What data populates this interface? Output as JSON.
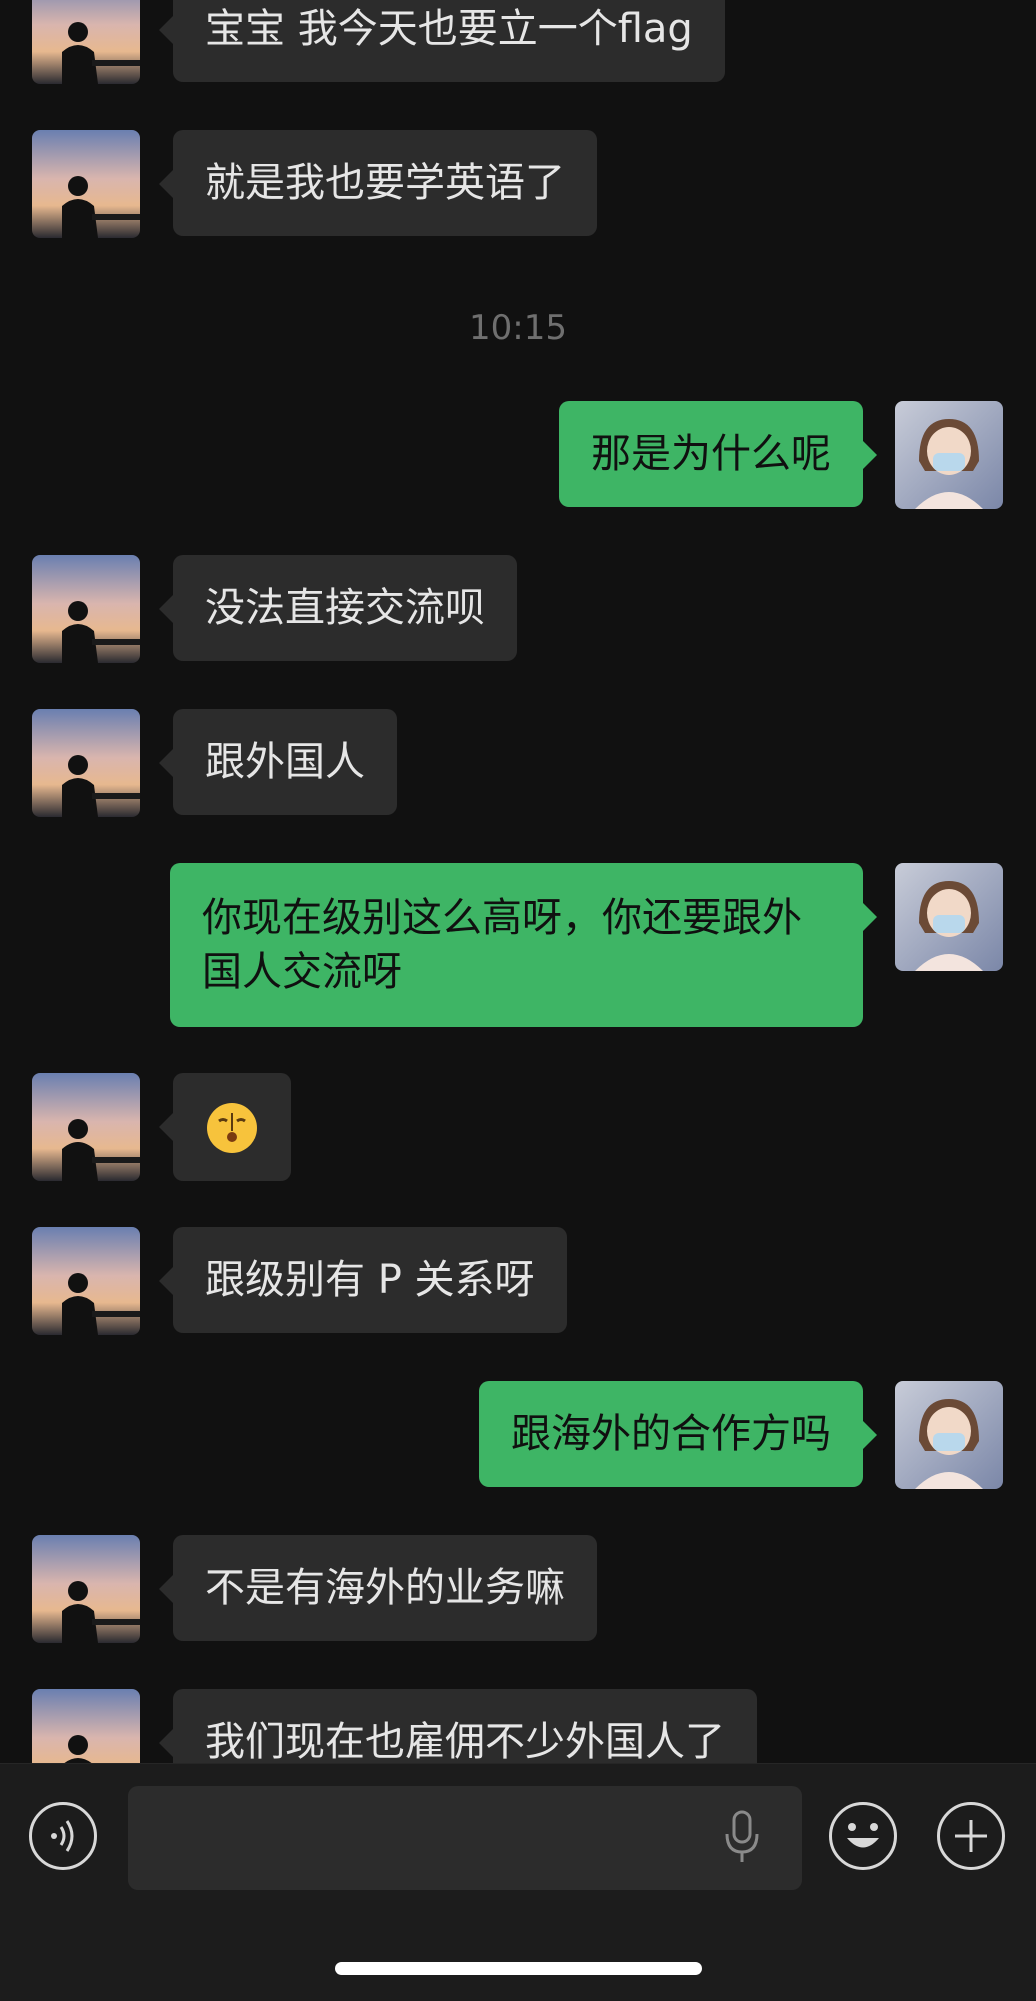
{
  "chat": {
    "timestamp": "10:15",
    "messages": [
      {
        "side": "in",
        "text": "宝宝 我今天也要立一个flag"
      },
      {
        "side": "in",
        "text": "就是我也要学英语了"
      },
      {
        "side": "out",
        "text": "那是为什么呢"
      },
      {
        "side": "in",
        "text": "没法直接交流呗"
      },
      {
        "side": "in",
        "text": "跟外国人"
      },
      {
        "side": "out",
        "text": "你现在级别这么高呀，你还要跟外国人交流呀"
      },
      {
        "side": "in",
        "text": "",
        "emoji": "kiss-emoji"
      },
      {
        "side": "in",
        "text": "跟级别有 P 关系呀"
      },
      {
        "side": "out",
        "text": "跟海外的合作方吗"
      },
      {
        "side": "in",
        "text": "不是有海外的业务嘛"
      },
      {
        "side": "in",
        "text": "我们现在也雇佣不少外国人了"
      }
    ]
  },
  "input_bar": {
    "placeholder": "",
    "icons": [
      "voice-icon",
      "mic-icon",
      "emoji-smile-icon",
      "plus-icon"
    ]
  }
}
